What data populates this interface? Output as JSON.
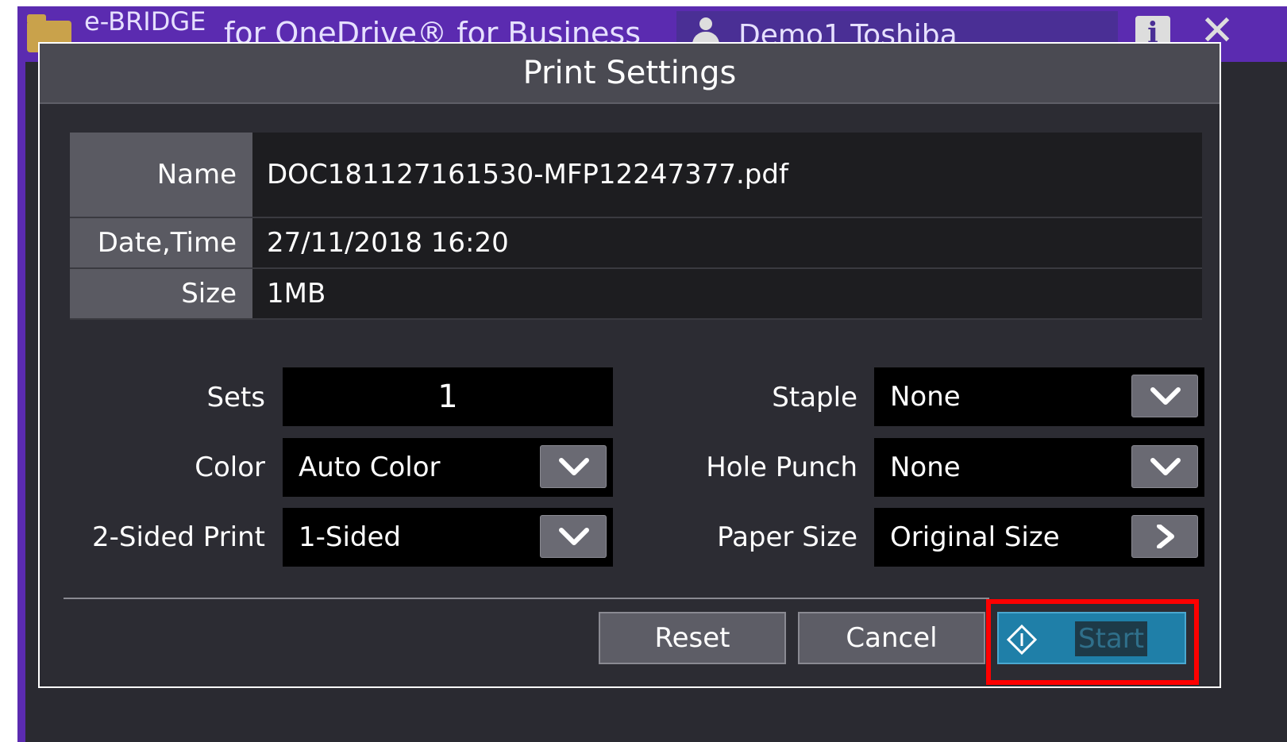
{
  "app": {
    "brand": "e-BRIDGE",
    "title": "for OneDrive® for Business",
    "user": "Demo1 Toshiba",
    "info_icon": "info-icon",
    "close_icon": "close-icon",
    "colors": {
      "title_bar": "#5b2bb0",
      "start_button": "#1f7fa8",
      "highlight": "#ff0000"
    }
  },
  "dialog": {
    "title": "Print Settings",
    "file_info": [
      {
        "label": "Name",
        "value": "DOC181127161530-MFP12247377.pdf"
      },
      {
        "label": "Date,Time",
        "value": "27/11/2018 16:20"
      },
      {
        "label": "Size",
        "value": "1MB"
      }
    ],
    "settings": {
      "sets": {
        "label": "Sets",
        "value": "1"
      },
      "color": {
        "label": "Color",
        "value": "Auto Color"
      },
      "two_sided": {
        "label": "2-Sided Print",
        "value": "1-Sided"
      },
      "staple": {
        "label": "Staple",
        "value": "None"
      },
      "hole_punch": {
        "label": "Hole Punch",
        "value": "None"
      },
      "paper_size": {
        "label": "Paper Size",
        "value": "Original Size"
      }
    },
    "buttons": {
      "reset": "Reset",
      "cancel": "Cancel",
      "start": "Start"
    }
  }
}
